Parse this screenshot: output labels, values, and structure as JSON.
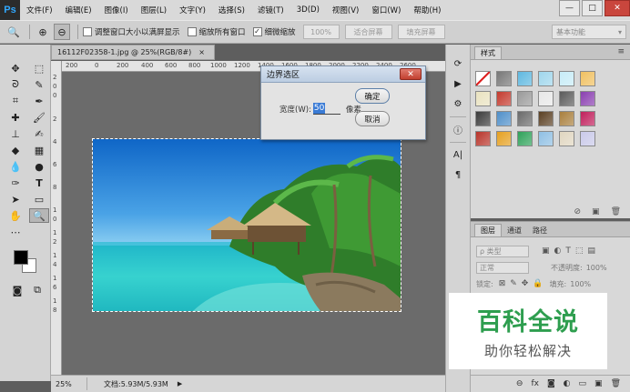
{
  "app": {
    "logo": "Ps"
  },
  "menu": [
    "文件(F)",
    "编辑(E)",
    "图像(I)",
    "图层(L)",
    "文字(Y)",
    "选择(S)",
    "滤镜(T)",
    "3D(D)",
    "视图(V)",
    "窗口(W)",
    "帮助(H)"
  ],
  "window_controls": {
    "minimize": "—",
    "restore": "□",
    "close": "✕"
  },
  "options_bar": {
    "resize_windows_label": "调整窗口大小以满屏显示",
    "zoom_all_windows_label": "缩放所有窗口",
    "scrubby_zoom_label": "细微缩放",
    "zoom_percent": "100%",
    "fit_screen": "适合屏幕",
    "fill_screen": "填充屏幕",
    "workspace": "基本功能",
    "scrubby_zoom_checked": true
  },
  "document": {
    "tab_title": "16112F02358-1.jpg @ 25%(RGB/8#)",
    "tab_close": "×",
    "ruler_top": [
      "200",
      "0",
      "200",
      "400",
      "600",
      "800",
      "1000",
      "1200",
      "1400",
      "1600",
      "1800",
      "2000",
      "2200",
      "2400",
      "2600"
    ],
    "ruler_left": [
      "2",
      "0",
      "0",
      "2",
      "4",
      "6",
      "8",
      "1",
      "0",
      "1",
      "2",
      "1",
      "4",
      "1",
      "6",
      "1",
      "8"
    ]
  },
  "status": {
    "zoom": "25%",
    "doc_info": "文档:5.93M/5.93M",
    "arrow": "▶"
  },
  "dialog": {
    "title": "边界选区",
    "close": "✕",
    "width_label": "宽度(W):",
    "width_value": "50",
    "unit": "像素",
    "ok": "确定",
    "cancel": "取消"
  },
  "styles_panel": {
    "tab": "样式",
    "swatch_colors": [
      "#ffffff",
      "#777777",
      "#5fb8e0",
      "#9fd6ec",
      "#c7ecf7",
      "#f0c060",
      "#e9e2c0",
      "#c43a2e",
      "#9a9a9a",
      "#e8e8e8",
      "#5a5a5a",
      "#8a3fb0",
      "#3a3a3a",
      "#4f8fc9",
      "#6a6a6a",
      "#5a3f22",
      "#a97f3d",
      "#c0205c",
      "#b8342a",
      "#e5a020",
      "#2fa25a",
      "#8fbfe3",
      "#e0d6c0",
      "#c9c9e9"
    ]
  },
  "layers_panel": {
    "tabs": [
      "图层",
      "通道",
      "路径"
    ],
    "filter_kind": "ρ 类型",
    "blend_mode": "正常",
    "opacity_label": "不透明度:",
    "opacity_value": "100%",
    "lock_label": "锁定:",
    "fill_label": "填充:",
    "fill_value": "100%"
  },
  "watermark": {
    "title": "百科全说",
    "subtitle": "助你轻松解决"
  }
}
